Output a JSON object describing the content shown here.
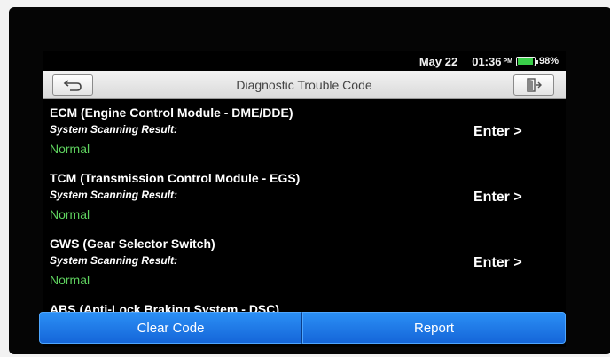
{
  "status_bar": {
    "date": "May 22",
    "time": "01:36",
    "ampm": "PM",
    "battery_percent": "98%",
    "battery_level": 0.98,
    "battery_color": "#3ad04a"
  },
  "header": {
    "title": "Diagnostic Trouble Code",
    "back_icon": "back-arrow-icon",
    "exit_icon": "exit-icon"
  },
  "modules": [
    {
      "name": "ECM (Engine Control Module - DME/DDE)",
      "result_label": "System Scanning Result:",
      "result": "Normal",
      "action": "Enter >"
    },
    {
      "name": "TCM (Transmission Control Module - EGS)",
      "result_label": "System Scanning Result:",
      "result": "Normal",
      "action": "Enter >"
    },
    {
      "name": "GWS (Gear Selector Switch)",
      "result_label": "System Scanning Result:",
      "result": "Normal",
      "action": "Enter >"
    },
    {
      "name": "ABS (Anti-Lock Braking System - DSC)"
    }
  ],
  "footer": {
    "clear_label": "Clear Code",
    "report_label": "Report"
  },
  "colors": {
    "normal_status": "#5fd35f",
    "button_blue": "#1e7cec"
  }
}
